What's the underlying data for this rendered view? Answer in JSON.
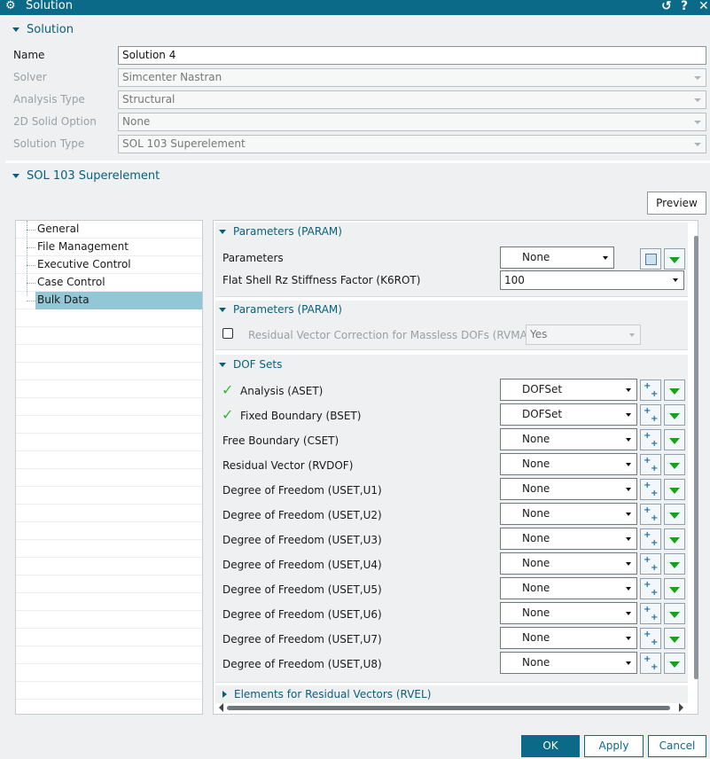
{
  "window": {
    "title": "Solution",
    "buttons": {
      "reset": "↺",
      "help": "?",
      "close": "✕"
    }
  },
  "solution_section": {
    "header": "Solution",
    "fields": [
      {
        "label": "Name",
        "value": "Solution 4",
        "enabled": true
      },
      {
        "label": "Solver",
        "value": "Simcenter Nastran",
        "enabled": false
      },
      {
        "label": "Analysis Type",
        "value": "Structural",
        "enabled": false
      },
      {
        "label": "2D Solid Option",
        "value": "None",
        "enabled": false
      },
      {
        "label": "Solution Type",
        "value": "SOL 103 Superelement",
        "enabled": false
      }
    ]
  },
  "sol_section": {
    "header": "SOL 103 Superelement"
  },
  "preview_label": "Preview",
  "tree": {
    "items": [
      "General",
      "File Management",
      "Executive Control",
      "Case Control",
      "Bulk Data"
    ],
    "selected": "Bulk Data"
  },
  "param_group1": {
    "header": "Parameters (PARAM)",
    "parameters_label": "Parameters",
    "parameters_value": "None",
    "k6rot_label": "Flat Shell Rz Stiffness Factor (K6ROT)",
    "k6rot_value": "100"
  },
  "param_group2": {
    "header": "Parameters (PARAM)",
    "rvmass_label": "Residual Vector Correction for Massless DOFs (RVMASS)",
    "rvmass_value": "Yes",
    "rvmass_checked": false
  },
  "dof_group": {
    "header": "DOF Sets",
    "rows": [
      {
        "label": "Analysis (ASET)",
        "value": "DOFSet",
        "checked": true
      },
      {
        "label": "Fixed Boundary (BSET)",
        "value": "DOFSet",
        "checked": true
      },
      {
        "label": "Free Boundary (CSET)",
        "value": "None",
        "checked": false
      },
      {
        "label": "Residual Vector (RVDOF)",
        "value": "None",
        "checked": false
      },
      {
        "label": "Degree of Freedom (USET,U1)",
        "value": "None",
        "checked": false
      },
      {
        "label": "Degree of Freedom (USET,U2)",
        "value": "None",
        "checked": false
      },
      {
        "label": "Degree of Freedom (USET,U3)",
        "value": "None",
        "checked": false
      },
      {
        "label": "Degree of Freedom (USET,U4)",
        "value": "None",
        "checked": false
      },
      {
        "label": "Degree of Freedom (USET,U5)",
        "value": "None",
        "checked": false
      },
      {
        "label": "Degree of Freedom (USET,U6)",
        "value": "None",
        "checked": false
      },
      {
        "label": "Degree of Freedom (USET,U7)",
        "value": "None",
        "checked": false
      },
      {
        "label": "Degree of Freedom (USET,U8)",
        "value": "None",
        "checked": false
      }
    ]
  },
  "rvel_group": {
    "header": "Elements for Residual Vectors (RVEL)"
  },
  "footer": {
    "ok": "OK",
    "apply": "Apply",
    "cancel": "Cancel"
  },
  "colors": {
    "accent": "#0a6a87",
    "selection": "#94c7d6",
    "check": "#37b533",
    "green_arrow": "#1aa11a"
  },
  "icons": [
    "gear-icon",
    "reset-icon",
    "help-icon",
    "close-icon",
    "add-dofset-icon",
    "dropdown-menu-icon",
    "parameter-list-icon",
    "checkmark-icon"
  ]
}
